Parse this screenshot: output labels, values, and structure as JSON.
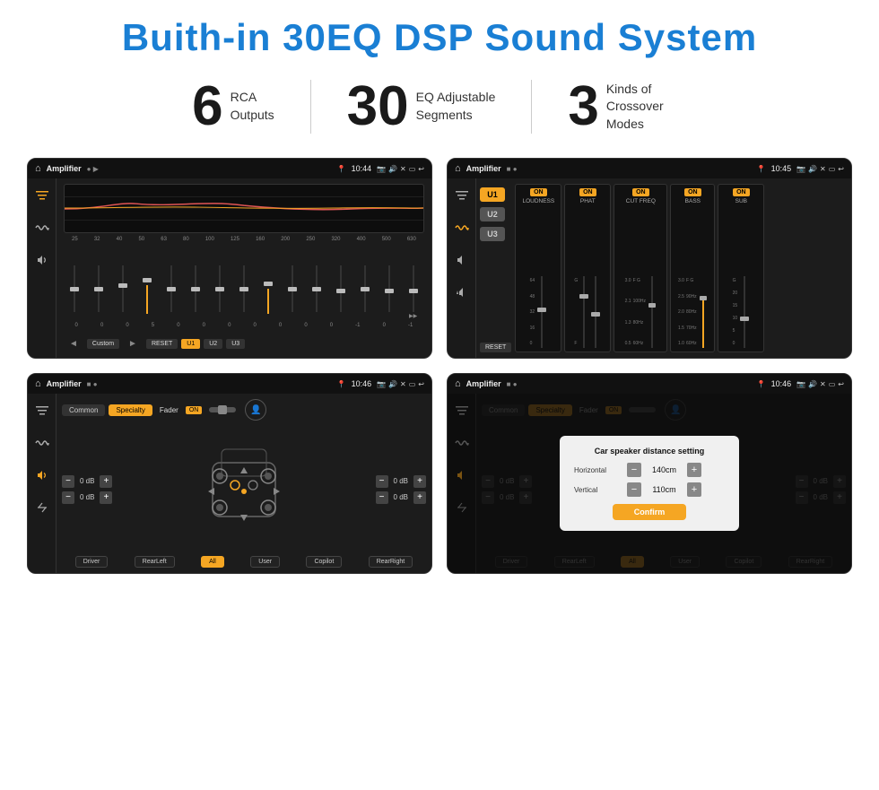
{
  "header": {
    "title": "Buith-in 30EQ DSP Sound System"
  },
  "stats": [
    {
      "number": "6",
      "label_line1": "RCA",
      "label_line2": "Outputs"
    },
    {
      "number": "30",
      "label_line1": "EQ Adjustable",
      "label_line2": "Segments"
    },
    {
      "number": "3",
      "label_line1": "Kinds of",
      "label_line2": "Crossover Modes"
    }
  ],
  "screens": {
    "eq": {
      "status_bar": {
        "app_name": "Amplifier",
        "time": "10:44"
      },
      "freq_labels": [
        "25",
        "32",
        "40",
        "50",
        "63",
        "80",
        "100",
        "125",
        "160",
        "200",
        "250",
        "320",
        "400",
        "500",
        "630"
      ],
      "slider_values": [
        "0",
        "0",
        "0",
        "5",
        "0",
        "0",
        "0",
        "0",
        "0",
        "0",
        "0",
        "-1",
        "0",
        "-1"
      ],
      "controls": {
        "prev": "◄",
        "preset": "Custom",
        "play": "►",
        "reset": "RESET",
        "u1": "U1",
        "u2": "U2",
        "u3": "U3"
      }
    },
    "crossover": {
      "status_bar": {
        "app_name": "Amplifier",
        "time": "10:45"
      },
      "u_buttons": [
        "U1",
        "U2",
        "U3"
      ],
      "reset_label": "RESET",
      "panels": [
        {
          "on": "ON",
          "label": "LOUDNESS"
        },
        {
          "on": "ON",
          "label": "PHAT"
        },
        {
          "on": "ON",
          "label": "CUT FREQ"
        },
        {
          "on": "ON",
          "label": "BASS"
        },
        {
          "on": "ON",
          "label": "SUB"
        }
      ]
    },
    "fader": {
      "status_bar": {
        "app_name": "Amplifier",
        "time": "10:46"
      },
      "tabs": [
        "Common",
        "Specialty"
      ],
      "fader_label": "Fader",
      "on_label": "ON",
      "controls": {
        "left_top": "0 dB",
        "left_bottom": "0 dB",
        "right_top": "0 dB",
        "right_bottom": "0 dB"
      },
      "footer": [
        "Driver",
        "RearLeft",
        "All",
        "User",
        "Copilot",
        "RearRight"
      ]
    },
    "dialog": {
      "status_bar": {
        "app_name": "Amplifier",
        "time": "10:46"
      },
      "tabs": [
        "Common",
        "Specialty"
      ],
      "fader_label": "Fader",
      "on_label": "ON",
      "dialog": {
        "title": "Car speaker distance setting",
        "horizontal_label": "Horizontal",
        "horizontal_value": "140cm",
        "vertical_label": "Vertical",
        "vertical_value": "110cm",
        "confirm_label": "Confirm"
      },
      "controls": {
        "right_top": "0 dB",
        "right_bottom": "0 dB"
      },
      "footer": [
        "Driver",
        "RearLeft",
        "All",
        "User",
        "Copilot",
        "RearRight"
      ]
    }
  }
}
